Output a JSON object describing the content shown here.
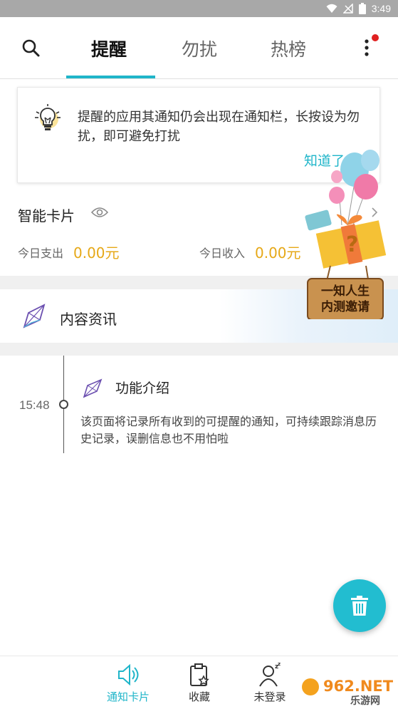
{
  "status_bar": {
    "time": "3:49",
    "icons": [
      "wifi-icon",
      "signal-off-icon",
      "battery-icon"
    ]
  },
  "top_tabs": [
    {
      "label": "提醒",
      "active": true
    },
    {
      "label": "勿扰",
      "active": false
    },
    {
      "label": "热榜",
      "active": false
    }
  ],
  "tip": {
    "text": "提醒的应用其通知仍会出现在通知栏，长按设为勿扰，即可避免打扰",
    "ok_label": "知道了"
  },
  "smart_card": {
    "title": "智能卡片",
    "expense_label": "今日支出",
    "expense_value": "0.00元",
    "income_label": "今日收入",
    "income_value": "0.00元"
  },
  "content_section": {
    "title": "内容资讯"
  },
  "timeline": [
    {
      "time": "15:48",
      "title": "功能介绍",
      "desc": "该页面将记录所有收到的可提醒的通知，可持续跟踪消息历史记录，误删信息也不用怕啦"
    }
  ],
  "promo": {
    "line1": "一知人生",
    "line2": "内测邀请"
  },
  "bottom_nav": [
    {
      "label": "通知卡片",
      "icon": "speaker-icon",
      "active": true
    },
    {
      "label": "收藏",
      "icon": "clipboard-star-icon",
      "active": false
    },
    {
      "label": "未登录",
      "icon": "user-sleep-icon",
      "active": false
    }
  ],
  "watermark": {
    "brand": "962.NET",
    "sub": "乐游网"
  },
  "colors": {
    "accent": "#1fb5c9",
    "amount": "#e6a817",
    "badge": "#e02020"
  }
}
